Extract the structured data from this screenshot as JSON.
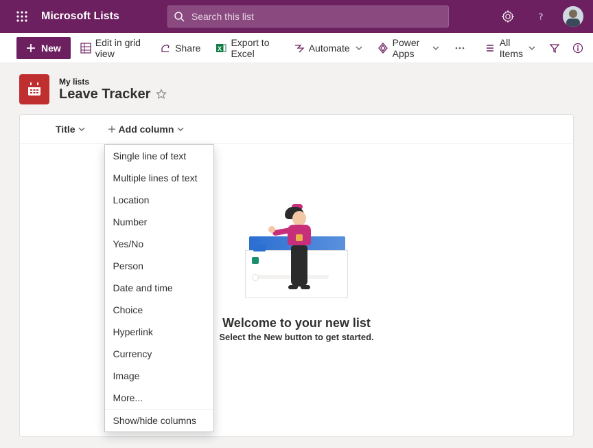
{
  "app": {
    "name": "Microsoft Lists"
  },
  "search": {
    "placeholder": "Search this list"
  },
  "commandBar": {
    "new": "New",
    "editGrid": "Edit in grid view",
    "share": "Share",
    "exportExcel": "Export to Excel",
    "automate": "Automate",
    "powerApps": "Power Apps",
    "allItems": "All Items"
  },
  "listHeader": {
    "crumb": "My lists",
    "name": "Leave Tracker"
  },
  "columns": {
    "title": "Title",
    "addColumn": "Add column"
  },
  "addColumnMenu": {
    "items": [
      "Single line of text",
      "Multiple lines of text",
      "Location",
      "Number",
      "Yes/No",
      "Person",
      "Date and time",
      "Choice",
      "Hyperlink",
      "Currency",
      "Image",
      "More..."
    ],
    "showHide": "Show/hide columns"
  },
  "emptyState": {
    "title": "Welcome to your new list",
    "subtitle": "Select the New button to get started."
  }
}
